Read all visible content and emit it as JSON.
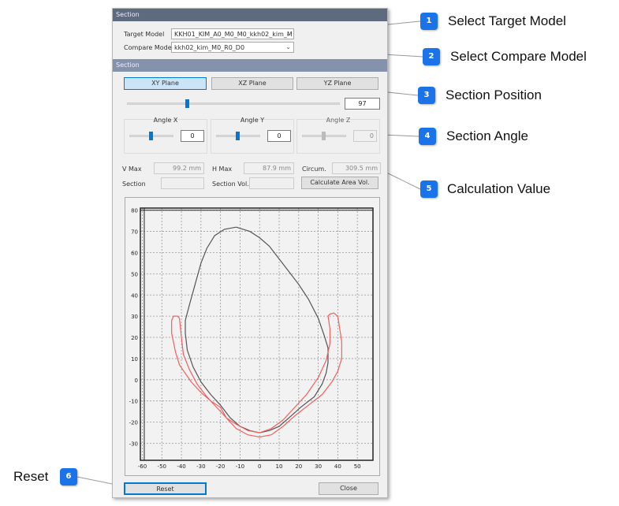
{
  "dialog": {
    "header1": "Section",
    "target_model_label": "Target Model",
    "target_model_value": "KKH01_KIM_A0_M0_M0_kkh02_kim_M",
    "compare_model_label": "Compare Model",
    "compare_model_value": "kkh02_kim_M0_R0_D0",
    "header2": "Section",
    "planes": [
      {
        "label": "XY Plane",
        "selected": true
      },
      {
        "label": "XZ Plane",
        "selected": false
      },
      {
        "label": "YZ Plane",
        "selected": false
      }
    ],
    "position_value": "97",
    "angles": [
      {
        "label": "Angle X",
        "value": "0",
        "enabled": true
      },
      {
        "label": "Angle Y",
        "value": "0",
        "enabled": true
      },
      {
        "label": "Angle Z",
        "value": "0",
        "enabled": false
      }
    ],
    "vmax_label": "V Max",
    "vmax_value": "99.2 mm",
    "hmax_label": "H Max",
    "hmax_value": "87.9 mm",
    "circum_label": "Circum.",
    "circum_value": "309.5 mm",
    "section_label": "Section",
    "section_value": "",
    "section_vol_label": "Section Vol.",
    "section_vol_value": "",
    "calc_button": "Calculate Area Vol.",
    "reset_button": "Reset",
    "close_button": "Close"
  },
  "annotations": [
    {
      "num": "1",
      "text": "Select Target Model"
    },
    {
      "num": "2",
      "text": "Select Compare Model"
    },
    {
      "num": "3",
      "text": "Section Position"
    },
    {
      "num": "4",
      "text": "Section Angle"
    },
    {
      "num": "5",
      "text": "Calculation Value"
    },
    {
      "num": "6",
      "text": "Reset"
    }
  ],
  "colors": {
    "accent": "#1a73e8",
    "target_curve": "#555555",
    "compare_curve": "#f06060"
  },
  "chart_data": {
    "type": "line",
    "xlim": [
      -61,
      58
    ],
    "ylim": [
      -38,
      81
    ],
    "xticks": [
      -60,
      -50,
      -40,
      -30,
      -20,
      -10,
      0,
      10,
      20,
      30,
      40,
      50
    ],
    "yticks": [
      80,
      70,
      60,
      50,
      40,
      30,
      20,
      10,
      0,
      -10,
      -20,
      -30
    ],
    "grid": true,
    "series": [
      {
        "color": "#555555",
        "points": [
          [
            -12,
            72
          ],
          [
            -5,
            70
          ],
          [
            0,
            67
          ],
          [
            5,
            63
          ],
          [
            10,
            57
          ],
          [
            15,
            51
          ],
          [
            20,
            45
          ],
          [
            25,
            38
          ],
          [
            30,
            29
          ],
          [
            33,
            21
          ],
          [
            35,
            15
          ],
          [
            35,
            8
          ],
          [
            34,
            3
          ],
          [
            32,
            -2
          ],
          [
            28,
            -8
          ],
          [
            21,
            -13
          ],
          [
            15,
            -18
          ],
          [
            10,
            -22
          ],
          [
            5,
            -24
          ],
          [
            0,
            -25
          ],
          [
            -5,
            -24
          ],
          [
            -10,
            -22
          ],
          [
            -15,
            -18
          ],
          [
            -20,
            -12
          ],
          [
            -25,
            -7
          ],
          [
            -30,
            -1
          ],
          [
            -34,
            6
          ],
          [
            -37,
            14
          ],
          [
            -38,
            22
          ],
          [
            -38,
            28
          ],
          [
            -36,
            35
          ],
          [
            -33,
            45
          ],
          [
            -30,
            55
          ],
          [
            -27,
            62
          ],
          [
            -23,
            68
          ],
          [
            -18,
            71
          ],
          [
            -12,
            72
          ]
        ]
      },
      {
        "color": "#f06060",
        "points": [
          [
            -41,
            29
          ],
          [
            -40,
            20
          ],
          [
            -39,
            12
          ],
          [
            -36,
            5
          ],
          [
            -32,
            -2
          ],
          [
            -27,
            -8
          ],
          [
            -22,
            -13
          ],
          [
            -17,
            -18
          ],
          [
            -12,
            -21
          ],
          [
            -6,
            -24
          ],
          [
            0,
            -25
          ],
          [
            6,
            -23
          ],
          [
            12,
            -19
          ],
          [
            18,
            -13
          ],
          [
            24,
            -7
          ],
          [
            30,
            1
          ],
          [
            34,
            9
          ],
          [
            36,
            17
          ],
          [
            36,
            24
          ],
          [
            35,
            30
          ],
          [
            36,
            31
          ],
          [
            38,
            31.5
          ],
          [
            40,
            30
          ],
          [
            41,
            24
          ],
          [
            42,
            18
          ],
          [
            42,
            10
          ],
          [
            40,
            4
          ],
          [
            37,
            -1
          ],
          [
            32,
            -7
          ],
          [
            25,
            -12
          ],
          [
            18,
            -17
          ],
          [
            12,
            -22
          ],
          [
            6,
            -26
          ],
          [
            0,
            -27
          ],
          [
            -6,
            -26
          ],
          [
            -12,
            -23
          ],
          [
            -17,
            -18
          ],
          [
            -20,
            -13
          ],
          [
            -25,
            -10
          ],
          [
            -30,
            -6
          ],
          [
            -35,
            -1
          ],
          [
            -38,
            3
          ],
          [
            -41,
            7
          ],
          [
            -43,
            13
          ],
          [
            -45,
            22
          ],
          [
            -45,
            28
          ],
          [
            -44,
            30
          ],
          [
            -42,
            30
          ],
          [
            -41,
            29
          ]
        ]
      }
    ]
  }
}
